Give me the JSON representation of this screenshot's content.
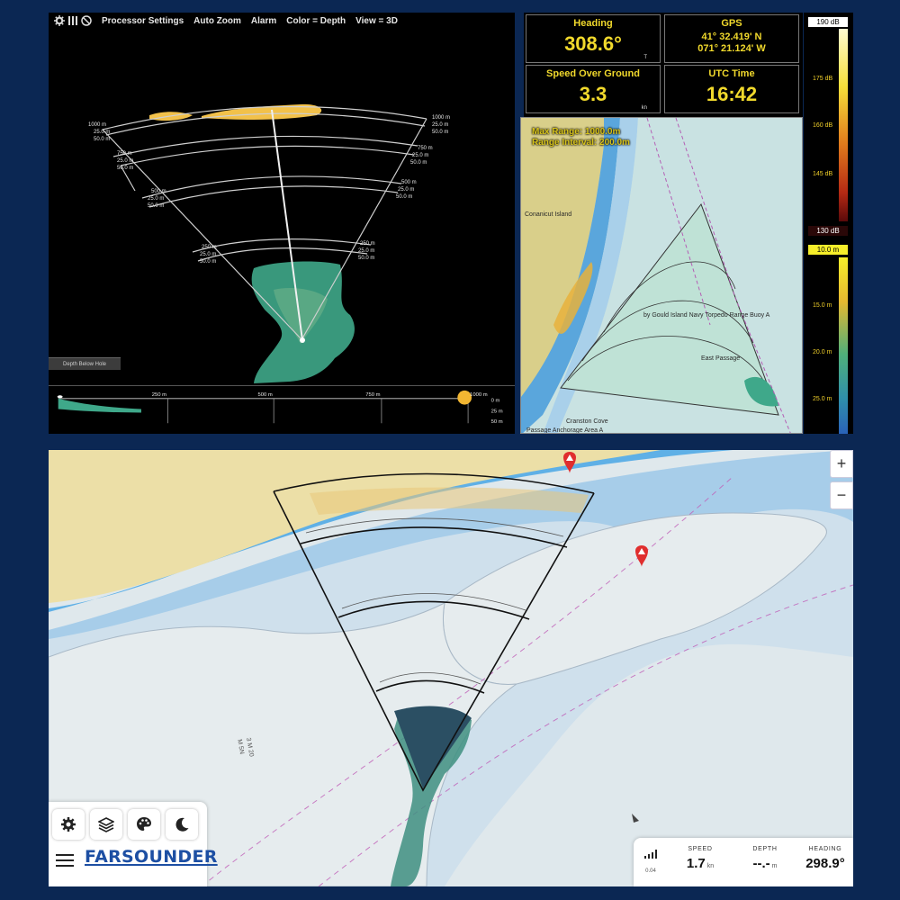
{
  "sonar": {
    "menu": [
      "Processor Settings",
      "Auto Zoom",
      "Alarm",
      "Color = Depth",
      "View = 3D"
    ],
    "range_labels": [
      {
        "range": "1000 m",
        "sub1": "25.0 m",
        "sub2": "50.0 m"
      },
      {
        "range": "750 m",
        "sub1": "25.0 m",
        "sub2": "50.0 m"
      },
      {
        "range": "500 m",
        "sub1": "25.0 m",
        "sub2": "50.0 m"
      },
      {
        "range": "250 m",
        "sub1": "25.0 m",
        "sub2": "50.0 m"
      }
    ],
    "depth_below_hole": "Depth Below Hole",
    "profile": {
      "ticks": [
        "250 m",
        "500 m",
        "750 m",
        "1000 m"
      ],
      "depths": [
        "0 m",
        "25 m",
        "50 m"
      ]
    },
    "colors": {
      "sonar_return": "#f2c14a",
      "seafloor": "#3fa88a"
    }
  },
  "instruments": {
    "heading": {
      "label": "Heading",
      "value": "308.6°",
      "unit": "T"
    },
    "gps": {
      "label": "GPS",
      "lat": "41° 32.419' N",
      "lon": "071° 21.124' W"
    },
    "sog": {
      "label": "Speed Over Ground",
      "value": "3.3",
      "unit": "kn"
    },
    "utc": {
      "label": "UTC Time",
      "value": "16:42"
    },
    "color": "#f1d92c"
  },
  "inset_chart": {
    "max_range": "Max Range: 1000.0m",
    "range_interval": "Range Interval: 200.0m",
    "labels": {
      "island": "Conanicut Island",
      "buoy": "by Gould Island Navy Torpedo Range Buoy A",
      "passage": "East Passage",
      "cove": "Cranston Cove",
      "anchorage": "Passage Anchorage Area A"
    }
  },
  "scale": {
    "intensity_max": "190 dB",
    "intensity_labels": [
      "175 dB",
      "160 dB",
      "145 dB"
    ],
    "intensity_min": "130 dB",
    "depth_min": "10.0 m",
    "depth_labels": [
      "15.0 m",
      "20.0 m",
      "25.0 m"
    ]
  },
  "nav": {
    "zoom_in": "+",
    "zoom_out": "−",
    "brand": "FARSOUNDER",
    "chart_marks": {
      "depth_text_1": "3 M 20",
      "depth_text_2": "M 5N"
    },
    "status": {
      "signal_value": "0.04",
      "speed_label": "SPEED",
      "speed_value": "1.7",
      "speed_unit": "kn",
      "depth_label": "DEPTH",
      "depth_value": "--.-",
      "depth_unit": "m",
      "heading_label": "HEADING",
      "heading_value": "298.9°"
    },
    "colors": {
      "land": "#ecdfa7",
      "shallow": "#5fb0e6",
      "mid": "#a7cde9",
      "deep": "#dfe8ec",
      "brand": "#1d4fa3",
      "alert": "#e02e2e"
    }
  }
}
